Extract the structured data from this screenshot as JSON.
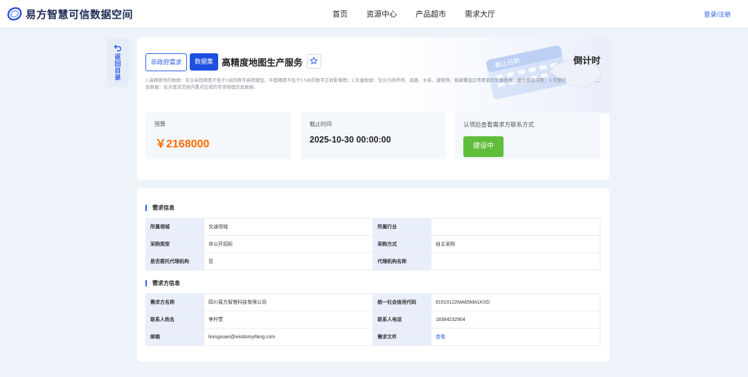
{
  "header": {
    "logo_text": "易方智慧可信数据空间",
    "nav": [
      "首页",
      "资源中心",
      "产品超市",
      "需求大厅"
    ],
    "login_label": "登录/注册"
  },
  "back": {
    "label": "返回目录"
  },
  "demand": {
    "tag_type": "非政府需求",
    "tag_category": "数据集",
    "title": "高精度地图生产服务",
    "description": "1.高精度地形数据：包含高程精度不低于1米的数字高程模型，平面精度不低于0.5米的数字正射影像图；2.矢量数据：包含行政界线、道路、水系、建筑物、植被覆盖区等要素的矢量数据，属性信息完整；3.专题信息数据：包含需求范围内重点区域的专项地理信息数据。",
    "countdown_label": "倒计时",
    "deco_label": "截止日期",
    "more": "..."
  },
  "summary": {
    "budget_label": "预算",
    "budget_value": "￥2168000",
    "deadline_label": "截止时间",
    "deadline_value": "2025-10-30 00:00:00",
    "contact_label": "认领后查看需求方联系方式",
    "status": "建设中"
  },
  "demand_info": {
    "title": "需求信息",
    "rows": [
      [
        "所属领域",
        "交通领域",
        "所属行业",
        ""
      ],
      [
        "采购类型",
        "非公开招标",
        "采购方式",
        "自主采购"
      ],
      [
        "是否委托代理机构",
        "否",
        "代理机构名称",
        ""
      ]
    ]
  },
  "party_info": {
    "title": "需求方信息",
    "rows": [
      [
        "需求方名称",
        "四川易方智慧科技有限公司",
        "统一社会信用代码",
        "91510122MA65MA1KXD"
      ],
      [
        "联系人姓名",
        "李柠萱",
        "联系人电话",
        "18384232904"
      ],
      [
        "邮箱",
        "liningxuan@wisdomyifang.com",
        "需求文件",
        "查看"
      ]
    ]
  },
  "colors": {
    "accent": "#2f5bea",
    "budget": "#ff6a00",
    "status": "#5fbe3a"
  }
}
